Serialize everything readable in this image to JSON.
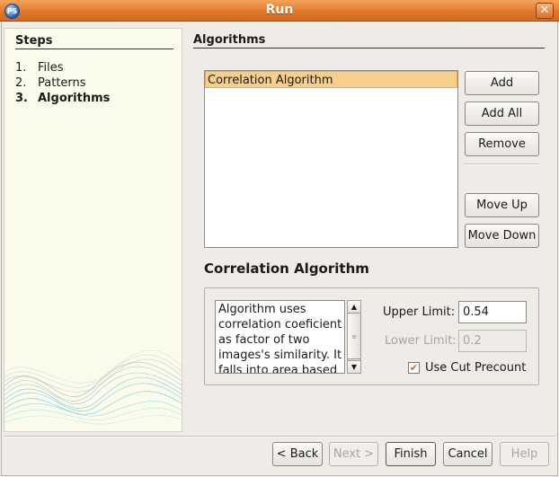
{
  "window": {
    "title": "Run",
    "app_icon_text": "PS",
    "close_glyph": "✕"
  },
  "steps": {
    "title": "Steps",
    "items": [
      {
        "num": "1.",
        "label": "Files"
      },
      {
        "num": "2.",
        "label": "Patterns"
      },
      {
        "num": "3.",
        "label": "Algorithms"
      }
    ]
  },
  "content": {
    "title": "Algorithms",
    "list_items": [
      "Correlation Algorithm"
    ],
    "buttons": {
      "add": "Add",
      "add_all": "Add All",
      "remove": "Remove",
      "move_up": "Move Up",
      "move_down": "Move Down"
    },
    "section_title": "Correlation Algorithm",
    "description": "Algorithm uses correlation coeficient as factor of two images's similarity. It falls into area based",
    "upper_limit": {
      "label": "Upper Limit:",
      "value": "0.54"
    },
    "lower_limit": {
      "label": "Lower Limit:",
      "value": "0.2"
    },
    "use_cut_precount": {
      "label": "Use Cut Precount",
      "checked": true
    }
  },
  "footer": {
    "back": "< Back",
    "next": "Next >",
    "finish": "Finish",
    "cancel": "Cancel",
    "help": "Help"
  },
  "colors": {
    "titlebar": "#e0782e",
    "selection": "#f7cf8b",
    "steps_bg": "#fbfbec",
    "checkmark": "#d56a13"
  }
}
